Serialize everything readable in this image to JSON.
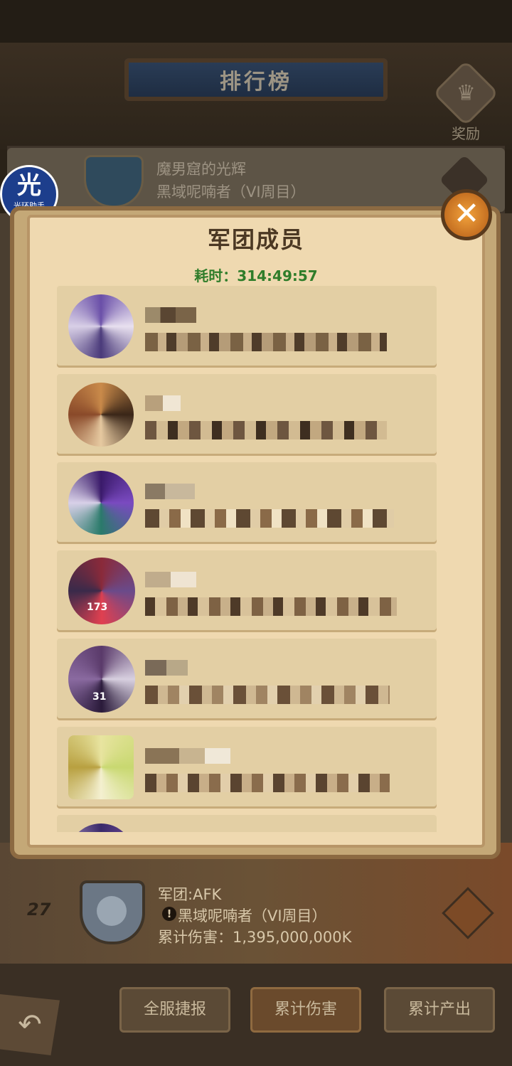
{
  "header": {
    "title": "排行榜",
    "reward_label": "奖励",
    "reward_icon": "trophy-icon"
  },
  "top_entry": {
    "name": "魔男窟的光辉",
    "boss": "黑域呢喃者（VI周目）"
  },
  "helper_badge": {
    "char": "光",
    "text": "光环助手"
  },
  "modal": {
    "title": "军团成员",
    "time": "耗时：314:49:57",
    "close_icon": "close-icon",
    "members": [
      {
        "badge": ""
      },
      {
        "badge": ""
      },
      {
        "badge": ""
      },
      {
        "badge": "173"
      },
      {
        "badge": "31"
      },
      {
        "badge": ""
      },
      {
        "badge": ""
      }
    ]
  },
  "my_guild": {
    "rank": "27",
    "name": "军团:AFK",
    "boss_icon": "!",
    "boss": "黑域呢喃者（VI周目）",
    "damage": "累计伤害：1,395,000,000K"
  },
  "bottom_tabs": [
    {
      "label": "全服捷报"
    },
    {
      "label": "累计伤害"
    },
    {
      "label": "累计产出"
    }
  ],
  "colors": {
    "accent_green": "#2f7d2a",
    "parchment": "#efd9b0",
    "close_orange": "#e08a2c"
  }
}
